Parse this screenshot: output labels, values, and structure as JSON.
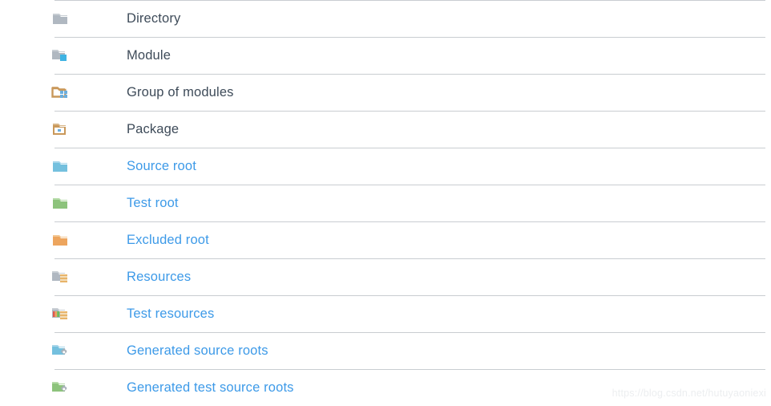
{
  "page": {
    "background_color": "#ffffff",
    "separator_color": "#c9cdd1",
    "plain_text_color": "#3e4b59",
    "link_text_color": "#3d9ae8"
  },
  "legend": {
    "rows": [
      {
        "label": "Directory",
        "icon": "folder-gray-icon",
        "style": "plain"
      },
      {
        "label": "Module",
        "icon": "folder-gray-blue-square-icon",
        "style": "plain"
      },
      {
        "label": "Group of modules",
        "icon": "folder-tan-grid-icon",
        "style": "plain"
      },
      {
        "label": "Package",
        "icon": "folder-tan-package-icon",
        "style": "plain"
      },
      {
        "label": "Source root",
        "icon": "folder-blue-icon",
        "style": "link"
      },
      {
        "label": "Test root",
        "icon": "folder-green-icon",
        "style": "link"
      },
      {
        "label": "Excluded root",
        "icon": "folder-orange-icon",
        "style": "link"
      },
      {
        "label": "Resources",
        "icon": "folder-gray-resources-icon",
        "style": "link"
      },
      {
        "label": "Test resources",
        "icon": "folder-gray-test-resources-icon",
        "style": "link"
      },
      {
        "label": "Generated source roots",
        "icon": "folder-blue-gear-icon",
        "style": "link"
      },
      {
        "label": "Generated test source roots",
        "icon": "folder-green-gear-icon",
        "style": "link"
      }
    ]
  },
  "watermark": {
    "text": "https://blog.csdn.net/hutuyaoniexi",
    "color": "#eceef0"
  },
  "icon_colors": {
    "gray_folder": "#b0b8c1",
    "gray_folder_tab": "#c8ced4",
    "blue_square": "#3fb3e3",
    "tan_folder": "#c9985a",
    "grid_blue": "#6aaede",
    "blue_folder": "#74c0de",
    "green_folder": "#8dc37c",
    "orange_folder": "#eda css",
    "orange_folder_hex": "#eda55e",
    "resource_orange": "#e8b469",
    "gear_gray": "#a8b0b8"
  }
}
